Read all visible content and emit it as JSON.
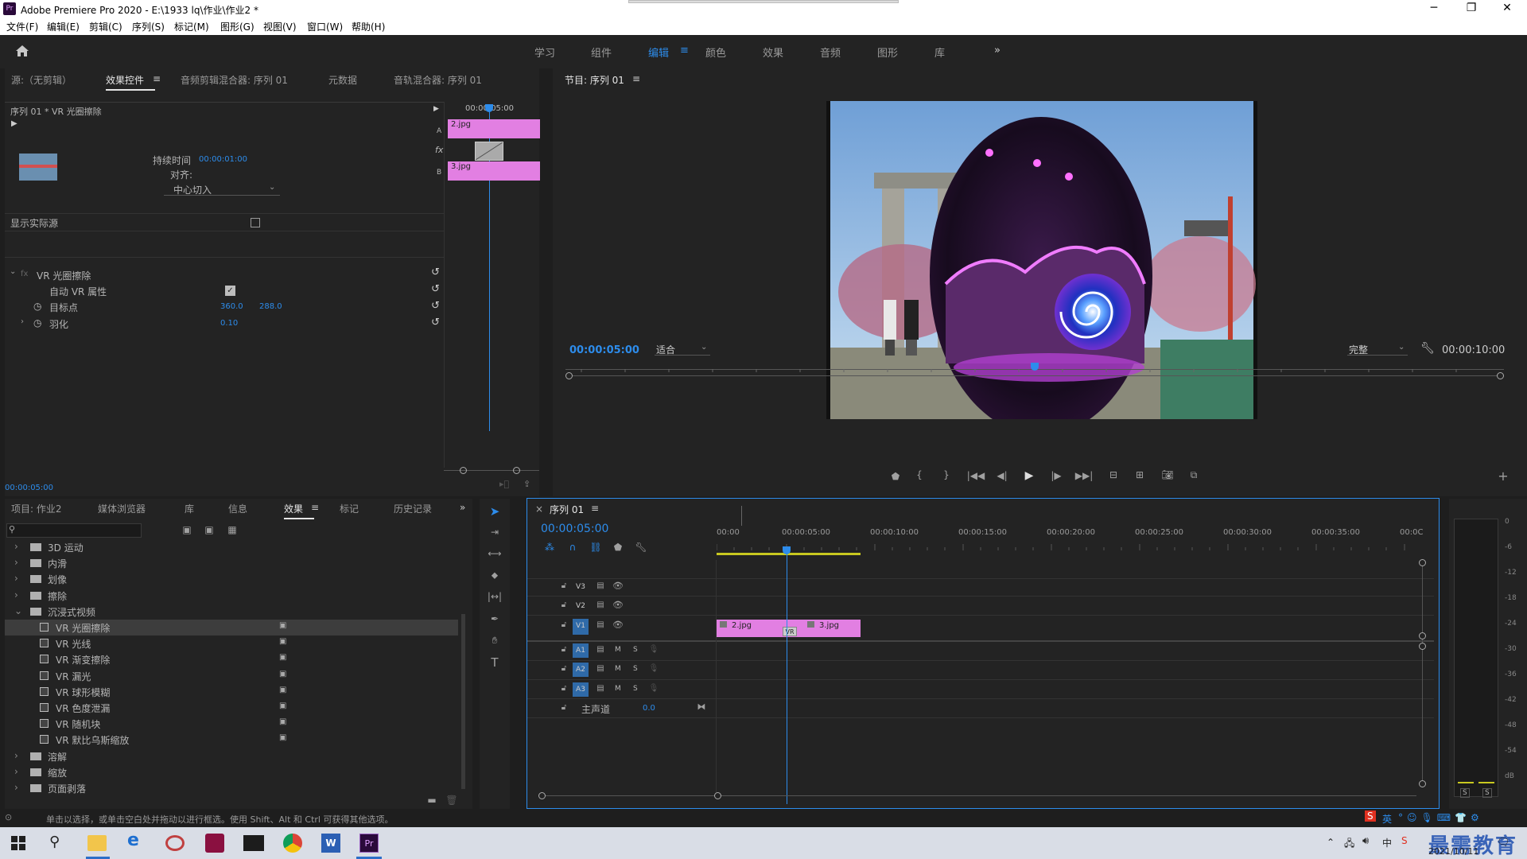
{
  "window": {
    "title": "Adobe Premiere Pro 2020 - E:\\1933 lq\\作业\\作业2 *",
    "logo": "Pr",
    "minimize": "─",
    "maximize": "❐",
    "close": "✕"
  },
  "menu": [
    "文件(F)",
    "编辑(E)",
    "剪辑(C)",
    "序列(S)",
    "标记(M)",
    "图形(G)",
    "视图(V)",
    "窗口(W)",
    "帮助(H)"
  ],
  "workspaces": [
    "学习",
    "组件",
    "编辑",
    "颜色",
    "效果",
    "音频",
    "图形",
    "库"
  ],
  "workspace_active": "编辑",
  "workspace_more": "»",
  "source_tabs": {
    "source": "源:（无剪辑）",
    "effect_controls": "效果控件",
    "audio_mixer": "音频剪辑混合器: 序列 01",
    "metadata": "元数据",
    "track_mixer": "音轨混合器: 序列 01"
  },
  "effect_controls": {
    "header": "序列 01 * VR 光圈擦除",
    "duration_label": "持续时间",
    "duration_value": "00:00:01:00",
    "align_label": "对齐:",
    "align_value": "中心切入",
    "show_source_label": "显示实际源",
    "effect_name": "VR 光圈擦除",
    "auto_vr_label": "自动 VR 属性",
    "target_label": "目标点",
    "target_x": "360.0",
    "target_y": "288.0",
    "feather_label": "羽化",
    "feather_value": "0.10",
    "mini_time": "00:00:05:00",
    "clip_a": "2.jpg",
    "clip_b": "3.jpg",
    "label_a": "A",
    "label_b": "B",
    "fx": "fx",
    "timecode": "00:00:05:00"
  },
  "program": {
    "title": "节目: 序列 01",
    "timecode": "00:00:05:00",
    "fit": "适合",
    "quality": "完整",
    "duration": "00:00:10:00",
    "playhead_fraction": 0.5
  },
  "project_tabs": {
    "project": "项目: 作业2",
    "media_browser": "媒体浏览器",
    "library": "库",
    "info": "信息",
    "effects": "效果",
    "markers": "标记",
    "history": "历史记录"
  },
  "effects_tree": [
    {
      "type": "folder",
      "label": "3D 运动",
      "open": false
    },
    {
      "type": "folder",
      "label": "内滑",
      "open": false
    },
    {
      "type": "folder",
      "label": "划像",
      "open": false
    },
    {
      "type": "folder",
      "label": "擦除",
      "open": false
    },
    {
      "type": "folder",
      "label": "沉浸式视频",
      "open": true
    },
    {
      "type": "fx",
      "label": "VR 光圈擦除",
      "selected": true
    },
    {
      "type": "fx",
      "label": "VR 光线"
    },
    {
      "type": "fx",
      "label": "VR 渐变擦除"
    },
    {
      "type": "fx",
      "label": "VR 漏光"
    },
    {
      "type": "fx",
      "label": "VR 球形模糊"
    },
    {
      "type": "fx",
      "label": "VR 色度泄漏"
    },
    {
      "type": "fx",
      "label": "VR 随机块"
    },
    {
      "type": "fx",
      "label": "VR 默比乌斯缩放"
    },
    {
      "type": "folder",
      "label": "溶解",
      "open": false
    },
    {
      "type": "folder",
      "label": "缩放",
      "open": false
    },
    {
      "type": "folder",
      "label": "页面剥落",
      "open": false
    }
  ],
  "timeline": {
    "title": "序列 01",
    "timecode": "00:00:05:00",
    "ruler": [
      "00:00",
      "00:00:05:00",
      "00:00:10:00",
      "00:00:15:00",
      "00:00:20:00",
      "00:00:25:00",
      "00:00:30:00",
      "00:00:35:00",
      "00:0C"
    ],
    "video_tracks": [
      "V3",
      "V2",
      "V1"
    ],
    "audio_tracks": [
      "A1",
      "A2",
      "A3"
    ],
    "master_label": "主声道",
    "master_value": "0.0",
    "clip1": "2.jpg",
    "clip2": "3.jpg",
    "transition": "VR",
    "m": "M",
    "s": "S"
  },
  "meter_scale": [
    "0",
    "-6",
    "-12",
    "-18",
    "-24",
    "-30",
    "-36",
    "-42",
    "-48",
    "-54",
    "dB"
  ],
  "meter_solo": [
    "S",
    "S"
  ],
  "status": "单击以选择，或单击空白处并拖动以进行框选。使用 Shift、Alt 和 Ctrl 可获得其他选项。",
  "taskbar": {
    "date": "2021/10/11",
    "ime": "英",
    "watermark": "最需教育"
  },
  "colors": {
    "accent": "#2d8ceb",
    "clip": "#e27fe2",
    "panel": "#232323",
    "timeline_border": "#2d8ceb"
  }
}
